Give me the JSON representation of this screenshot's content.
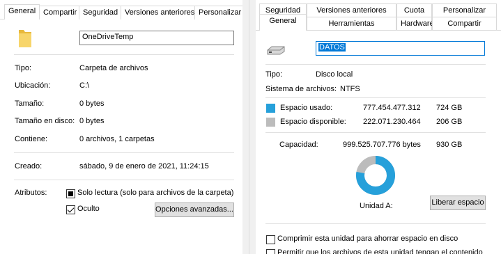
{
  "left": {
    "tabs": [
      "General",
      "Compartir",
      "Seguridad",
      "Versiones anteriores",
      "Personalizar"
    ],
    "folder_name": "OneDriveTemp",
    "rows": [
      {
        "label": "Tipo:",
        "value": "Carpeta de archivos"
      },
      {
        "label": "Ubicación:",
        "value": "C:\\"
      },
      {
        "label": "Tamaño:",
        "value": "0 bytes"
      },
      {
        "label": "Tamaño en disco:",
        "value": "0 bytes"
      },
      {
        "label": "Contiene:",
        "value": "0 archivos, 1 carpetas"
      },
      {
        "label": "Creado:",
        "value": "sábado, 9 de enero de 2021, 11:24:15"
      }
    ],
    "attributes_label": "Atributos:",
    "readonly_label": "Solo lectura (solo para archivos de la carpeta)",
    "hidden_label": "Oculto",
    "advanced_button": "Opciones avanzadas..."
  },
  "right": {
    "tabs_row1": [
      "Seguridad",
      "Versiones anteriores",
      "Cuota",
      "Personalizar"
    ],
    "tabs_row2": [
      "General",
      "Herramientas",
      "Hardware",
      "Compartir"
    ],
    "drive_name": "DATOS",
    "type_label": "Tipo:",
    "type_value": "Disco local",
    "fs_label": "Sistema de archivos:",
    "fs_value": "NTFS",
    "used_label": "Espacio usado:",
    "used_bytes": "777.454.477.312",
    "used_gb": "724 GB",
    "free_label": "Espacio disponible:",
    "free_bytes": "222.071.230.464",
    "free_gb": "206 GB",
    "capacity_label": "Capacidad:",
    "capacity_bytes": "999.525.707.776 bytes",
    "capacity_gb": "930 GB",
    "drive_label": "Unidad A:",
    "cleanup_button": "Liberar espacio",
    "compress_label": "Comprimir esta unidad para ahorrar espacio en disco",
    "index_label": "Permitir que los archivos de esta unidad tengan el contenido",
    "used_fraction": 0.778,
    "colors": {
      "used": "#26a0da",
      "free": "#bcbcbc",
      "selection": "#0078d7"
    }
  }
}
